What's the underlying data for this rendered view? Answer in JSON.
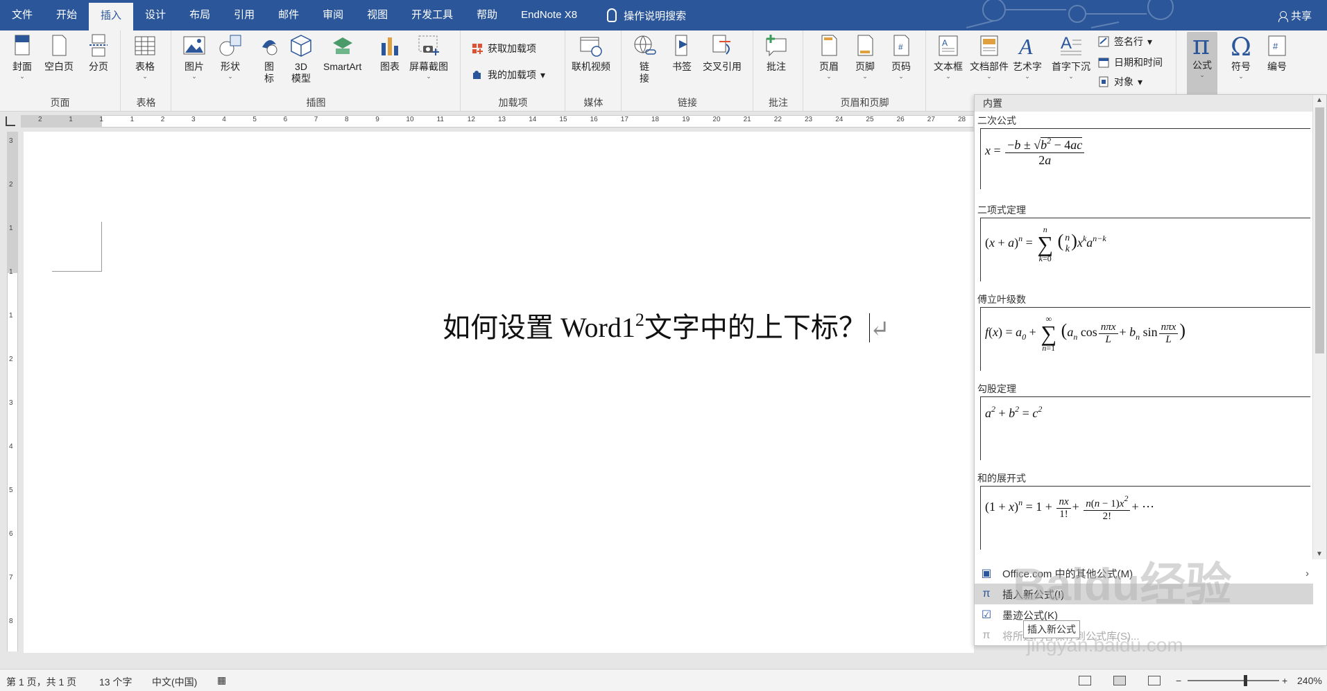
{
  "tabs": [
    "文件",
    "开始",
    "插入",
    "设计",
    "布局",
    "引用",
    "邮件",
    "审阅",
    "视图",
    "开发工具",
    "帮助",
    "EndNote X8"
  ],
  "active_tab": "插入",
  "tell_me": "操作说明搜索",
  "share": "共享",
  "ribbon": {
    "pages": {
      "cover": "封面",
      "blank": "空白页",
      "break": "分页",
      "label": "页面"
    },
    "tables": {
      "table": "表格",
      "label": "表格"
    },
    "illustrations": {
      "picture": "图片",
      "shapes": "形状",
      "icons_l1": "图",
      "icons_l2": "标",
      "model_l1": "3D",
      "model_l2": "模型",
      "smartart": "SmartArt",
      "chart": "图表",
      "screenshot": "屏幕截图",
      "label": "插图"
    },
    "addins": {
      "get": "获取加载项",
      "my": "我的加载项",
      "label": "加载项"
    },
    "media": {
      "video": "联机视频",
      "label": "媒体"
    },
    "links": {
      "link_l1": "链",
      "link_l2": "接",
      "bookmark": "书签",
      "crossref": "交叉引用",
      "label": "链接"
    },
    "comments": {
      "comment": "批注",
      "label": "批注"
    },
    "header_footer": {
      "header": "页眉",
      "footer": "页脚",
      "page_number": "页码",
      "label": "页眉和页脚"
    },
    "text": {
      "textbox": "文本框",
      "quickparts": "文档部件",
      "wordart": "艺术字",
      "dropcap": "首字下沉",
      "signature": "签名行",
      "datetime": "日期和时间",
      "object": "对象"
    },
    "symbols": {
      "equation": "公式",
      "symbol": "符号",
      "number": "编号"
    }
  },
  "ruler_numbers": [
    "2",
    "1",
    "1",
    "1",
    "2",
    "3",
    "4",
    "5",
    "6",
    "7",
    "8",
    "9",
    "10",
    "11",
    "12",
    "13",
    "14",
    "15",
    "16",
    "17",
    "18",
    "19",
    "20",
    "21",
    "22",
    "23",
    "24",
    "25",
    "26",
    "27",
    "28"
  ],
  "vruler_numbers": [
    "3",
    "2",
    "1",
    "1",
    "1",
    "2",
    "3",
    "4",
    "5",
    "6",
    "7",
    "8"
  ],
  "document": {
    "text_before": "如何设置 Word1",
    "superscript": "2",
    "text_after": "文字中的上下标？"
  },
  "gallery": {
    "header": "内置",
    "sections": [
      {
        "title": "二次公式"
      },
      {
        "title": "二项式定理"
      },
      {
        "title": "傅立叶级数"
      },
      {
        "title": "勾股定理"
      },
      {
        "title": "和的展开式"
      }
    ],
    "menu": {
      "office": "Office.com 中的其他公式(M)",
      "insert_new": "插入新公式(I)",
      "ink": "墨迹公式(K)",
      "save": "将所选内容保存到公式库(S)..."
    },
    "tooltip": "插入新公式"
  },
  "status": {
    "page": "第 1 页，共 1 页",
    "words": "13 个字",
    "lang": "中文(中国)",
    "zoom": "240%"
  },
  "watermark": {
    "brand": "Baidu经验",
    "url": "jingyan.baidu.com"
  }
}
